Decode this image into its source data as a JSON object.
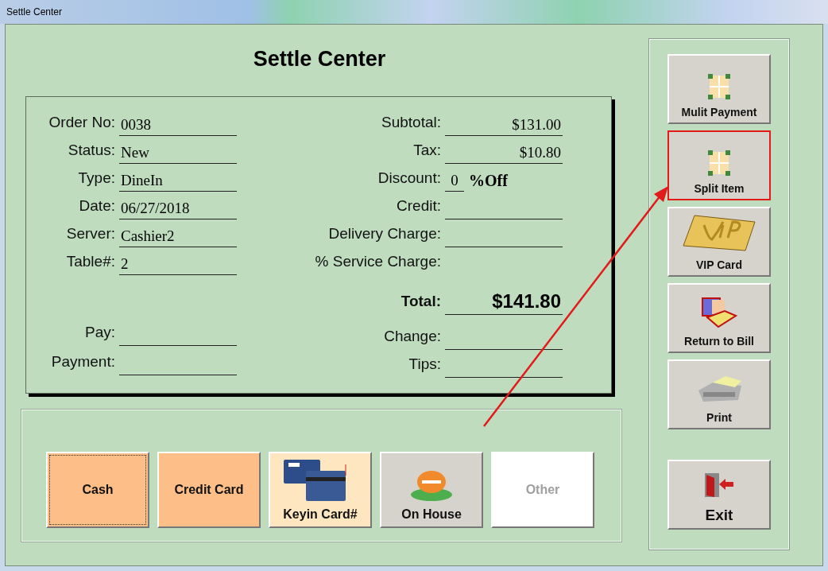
{
  "window": {
    "title": "Settle Center"
  },
  "heading": "Settle Center",
  "order_fields": [
    {
      "label": "Order No:",
      "value": "0038"
    },
    {
      "label": "Status:",
      "value": "New"
    },
    {
      "label": "Type:",
      "value": "DineIn"
    },
    {
      "label": "Date:",
      "value": "06/27/2018"
    },
    {
      "label": "Server:",
      "value": "Cashier2"
    },
    {
      "label": "Table#:",
      "value": "2"
    }
  ],
  "pay_fields": [
    {
      "label": "Pay:"
    },
    {
      "label": "Payment:"
    }
  ],
  "amount_fields": [
    {
      "kind": "line",
      "label": "Subtotal:",
      "value": "$131.00"
    },
    {
      "kind": "line",
      "label": "Tax:",
      "value": "$10.80"
    },
    {
      "kind": "discount",
      "label": "Discount:",
      "value": "0",
      "suffix": "%Off"
    },
    {
      "kind": "line",
      "label": "Credit:"
    },
    {
      "kind": "line",
      "label": "Delivery Charge:"
    },
    {
      "kind": "plain",
      "label": "% Service Charge:"
    },
    {
      "kind": "total",
      "label": "Total:",
      "value": "$141.80"
    },
    {
      "kind": "line",
      "label": "Change:"
    },
    {
      "kind": "line",
      "label": "Tips:"
    }
  ],
  "payment_buttons": [
    {
      "kind": "plain",
      "label": "Cash",
      "color": "#fdbf87",
      "focused": true,
      "disabled": false
    },
    {
      "kind": "plain",
      "label": "Credit Card",
      "color": "#fdbf87",
      "focused": false,
      "disabled": false
    },
    {
      "kind": "card",
      "label": "Keyin Card#",
      "color": "#fde6c0",
      "focused": false,
      "disabled": false
    },
    {
      "kind": "coin",
      "label": "On House",
      "color": "#d6d3cc",
      "focused": false,
      "disabled": false
    },
    {
      "kind": "plain",
      "label": "Other",
      "color": "#ffffff",
      "focused": false,
      "disabled": true
    }
  ],
  "side_buttons": [
    {
      "kind": "split",
      "label": "Mulit Payment",
      "highlighted": false
    },
    {
      "kind": "split",
      "label": "Split Item",
      "highlighted": true
    },
    {
      "kind": "vip",
      "label": "VIP Card",
      "highlighted": false
    },
    {
      "kind": "bill",
      "label": "Return to Bill",
      "highlighted": false
    },
    {
      "kind": "print",
      "label": "Print",
      "highlighted": false
    },
    {
      "kind": "exit",
      "label": "Exit",
      "highlighted": false
    }
  ]
}
